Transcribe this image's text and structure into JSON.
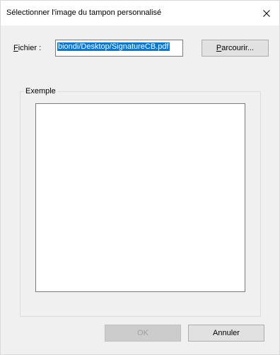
{
  "window": {
    "title": "Sélectionner l'image du tampon personnalisé",
    "close_icon": "close-icon"
  },
  "file": {
    "label_mnemonic": "F",
    "label_rest": "ichier :",
    "value": "biondi/Desktop/SignatureCB.pdf"
  },
  "browse_button": {
    "label_mnemonic": "P",
    "label_rest": "arcourir..."
  },
  "preview_group": {
    "legend": "Exemple"
  },
  "footer": {
    "ok_label": "OK",
    "ok_enabled": false,
    "cancel_label": "Annuler"
  },
  "colors": {
    "selection": "#0078d7",
    "dialog_bg": "#f0f0f0",
    "button_bg": "#e1e1e1"
  }
}
